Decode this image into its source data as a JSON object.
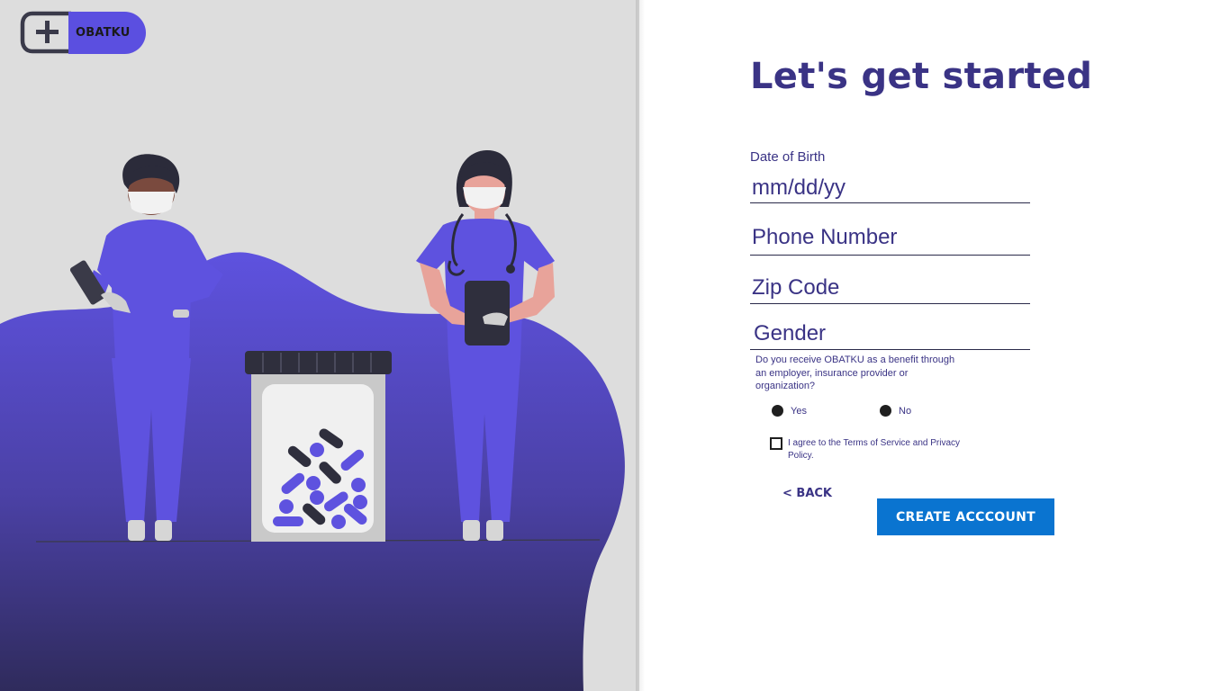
{
  "brand": {
    "name": "OBATKU"
  },
  "form": {
    "title": "Let's get started",
    "dob_label": "Date of Birth",
    "dob_placeholder": "mm/dd/yy",
    "phone_placeholder": "Phone Number",
    "zip_placeholder": "Zip Code",
    "gender_placeholder": "Gender",
    "benefit_question": "Do you receive OBATKU as a benefit through an employer, insurance provider or organization?",
    "options": {
      "yes": "Yes",
      "no": "No"
    },
    "terms_text": "I agree to the Terms of Service and Privacy Policy.",
    "back_label": "< BACK",
    "create_label": "CREATE ACCCOUNT"
  },
  "colors": {
    "accent": "#5b4fe0",
    "title": "#3a3385",
    "button": "#0a74d0",
    "left_panel": "#dddddd"
  },
  "icons": [
    "medical-cross-icon",
    "radio-filled-icon",
    "checkbox-icon"
  ]
}
